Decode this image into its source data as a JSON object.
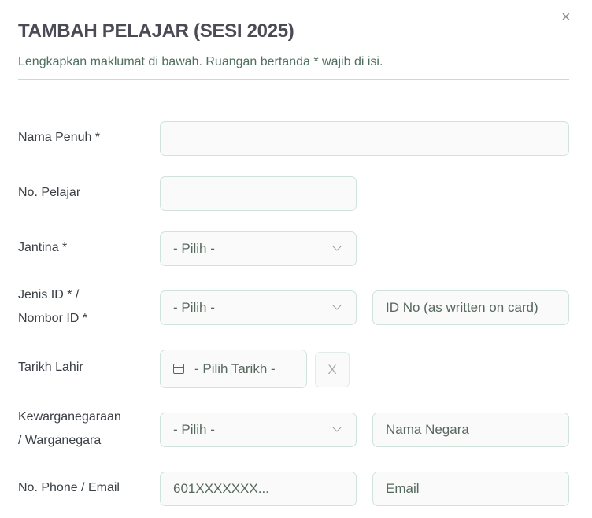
{
  "dialog": {
    "title": "TAMBAH PELAJAR (SESI 2025)",
    "subtitle": "Lengkapkan maklumat di bawah. Ruangan bertanda * wajib di isi.",
    "close_label": "×"
  },
  "form": {
    "nama_penuh": {
      "label": "Nama Penuh *",
      "value": ""
    },
    "no_pelajar": {
      "label": "No. Pelajar",
      "value": ""
    },
    "jantina": {
      "label": "Jantina *",
      "selected": "- Pilih -"
    },
    "jenis_id": {
      "label_line1": "Jenis ID * /",
      "label_line2": "Nombor ID *",
      "selected": "- Pilih -",
      "id_placeholder": "ID No (as written on card)"
    },
    "tarikh_lahir": {
      "label": "Tarikh Lahir",
      "placeholder": "- Pilih Tarikh -",
      "clear_label": "X"
    },
    "kewarganegaraan": {
      "label_line1": "Kewarganegaraan",
      "label_line2": "/ Warganegara",
      "selected": "- Pilih -",
      "negara_placeholder": "Nama Negara"
    },
    "contact": {
      "label": "No. Phone / Email",
      "phone_placeholder": "601XXXXXXX...",
      "email_placeholder": "Email"
    }
  }
}
